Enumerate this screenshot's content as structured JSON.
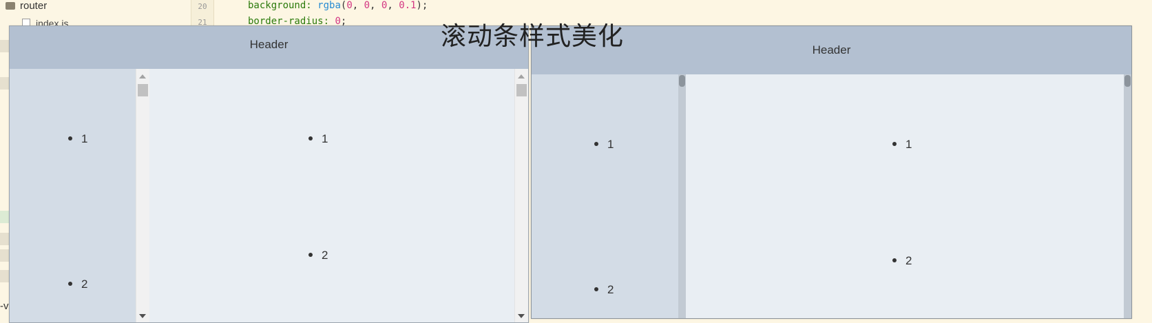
{
  "ide": {
    "tree_folder": "router",
    "tree_file": "index.js",
    "line_numbers": [
      "20",
      "21"
    ],
    "code_line1": {
      "prop": "background: ",
      "fn": "rgba",
      "open": "(",
      "n1": "0",
      "c1": ", ",
      "n2": "0",
      "c2": ", ",
      "n3": "0",
      "c3": ", ",
      "n4": "0.1",
      "close": ");"
    },
    "code_line2": {
      "prop": "border-radius: ",
      "val": "0",
      "end": ";"
    },
    "cut_text": "-v"
  },
  "title": "滚动条样式美化",
  "left_demo": {
    "header": "Header",
    "aside_items": [
      "1",
      "2"
    ],
    "main_items": [
      "1",
      "2"
    ]
  },
  "right_demo": {
    "header": "Header",
    "aside_items": [
      "1",
      "2"
    ],
    "main_items": [
      "1",
      "2"
    ]
  },
  "colors": {
    "header_bg": "#b3c0d1",
    "aside_bg": "#d3dce6",
    "main_bg": "#e9eef3",
    "styled_track": "#c2cad3",
    "styled_thumb": "#8c949c"
  }
}
